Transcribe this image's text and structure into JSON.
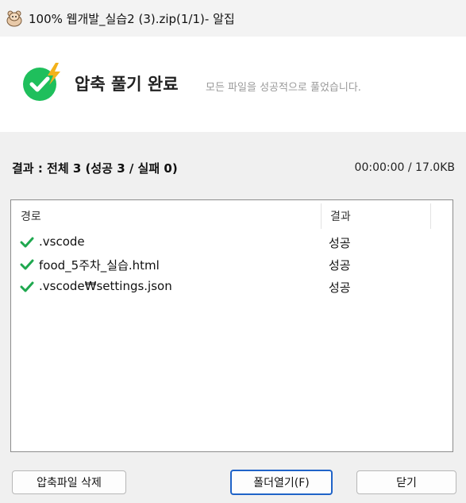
{
  "window": {
    "title": "100% 웹개발_실습2 (3).zip(1/1)- 알집"
  },
  "banner": {
    "title": "압축 풀기 완료",
    "subtitle": "모든 파일을 성공적으로 풀었습니다.",
    "accent_color": "#1fbf5c",
    "bolt_color": "#f3b21b"
  },
  "summary": {
    "result_text": "결과 : 전체 3 (성공 3 / 실패 0)",
    "stats_text": "00:00:00 / 17.0KB"
  },
  "list": {
    "columns": [
      "경로",
      "결과"
    ],
    "rows": [
      {
        "name": ".vscode",
        "result": "성공"
      },
      {
        "name": "food_5주차_실습.html",
        "result": "성공"
      },
      {
        "name": ".vscode₩settings.json",
        "result": "성공"
      }
    ],
    "check_color": "#1fa84f"
  },
  "buttons": {
    "delete_archive": "압축파일 삭제",
    "open_folder": "폴더열기(F)",
    "close": "닫기"
  }
}
